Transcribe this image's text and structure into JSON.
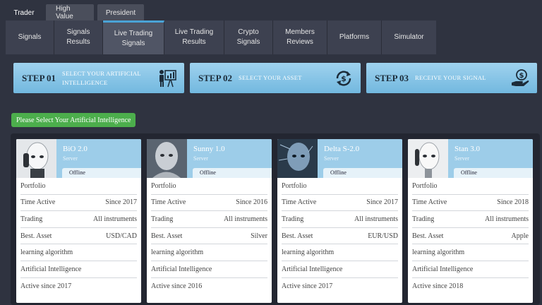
{
  "top_tabs": [
    {
      "label": "Trader",
      "active": true
    },
    {
      "label": "High Value",
      "active": false
    },
    {
      "label": "President",
      "active": false
    }
  ],
  "nav": [
    {
      "label": "Signals",
      "active": false
    },
    {
      "label": "Signals\nResults",
      "active": false
    },
    {
      "label": "Live Trading\nSignals",
      "active": true
    },
    {
      "label": "Live Trading\nResults",
      "active": false
    },
    {
      "label": "Crypto\nSignals",
      "active": false
    },
    {
      "label": "Members\nReviews",
      "active": false
    },
    {
      "label": "Platforms",
      "active": false
    },
    {
      "label": "Simulator",
      "active": false
    }
  ],
  "steps": [
    {
      "num": "STEP 01",
      "text": "SELECT YOUR ARTIFICIAL\nINTELLIGENCE",
      "icon": "presentation-chart-icon"
    },
    {
      "num": "STEP 02",
      "text": "SELECT YOUR ASSET",
      "icon": "dollar-exchange-icon"
    },
    {
      "num": "STEP 03",
      "text": "RECEIVE YOUR SIGNAL",
      "icon": "hand-coin-icon"
    }
  ],
  "select_button": "Please Select Your Artificial Intelligence",
  "cards": [
    {
      "name": "BiO 2.0",
      "subtitle": "Server",
      "status": "Offline",
      "rows": [
        {
          "label": "Portfolio",
          "value": ""
        },
        {
          "label": "Time Active",
          "value": "Since 2017"
        },
        {
          "label": "Trading",
          "value": "All instruments"
        },
        {
          "label": "Best. Asset",
          "value": "USD/CAD"
        },
        {
          "label": "learning algorithm",
          "value": ""
        },
        {
          "label": "Artificial Intelligence",
          "value": ""
        },
        {
          "label": "Active since 2017",
          "value": ""
        }
      ]
    },
    {
      "name": "Sunny 1.0",
      "subtitle": "Server",
      "status": "Offline",
      "rows": [
        {
          "label": "Portfolio",
          "value": ""
        },
        {
          "label": "Time Active",
          "value": "Since 2016"
        },
        {
          "label": "Trading",
          "value": "All instruments"
        },
        {
          "label": "Best. Asset",
          "value": "Silver"
        },
        {
          "label": "learning algorithm",
          "value": ""
        },
        {
          "label": "Artificial Intelligence",
          "value": ""
        },
        {
          "label": "Active since 2016",
          "value": ""
        }
      ]
    },
    {
      "name": "Delta S-2.0",
      "subtitle": "Server",
      "status": "Offline",
      "rows": [
        {
          "label": "Portfolio",
          "value": ""
        },
        {
          "label": "Time Active",
          "value": "Since 2017"
        },
        {
          "label": "Trading",
          "value": "All instruments"
        },
        {
          "label": "Best. Asset",
          "value": "EUR/USD"
        },
        {
          "label": "learning algorithm",
          "value": ""
        },
        {
          "label": "Artificial Intelligence",
          "value": ""
        },
        {
          "label": "Active since 2017",
          "value": ""
        }
      ]
    },
    {
      "name": "Stan 3.0",
      "subtitle": "Server",
      "status": "Offline",
      "rows": [
        {
          "label": "Portfolio",
          "value": ""
        },
        {
          "label": "Time Active",
          "value": "Since 2018"
        },
        {
          "label": "Trading",
          "value": "All instruments"
        },
        {
          "label": "Best. Asset",
          "value": "Apple"
        },
        {
          "label": "learning algorithm",
          "value": ""
        },
        {
          "label": "Artificial Intelligence",
          "value": ""
        },
        {
          "label": "Active since 2018",
          "value": ""
        }
      ]
    }
  ],
  "colors": {
    "background": "#2f3340",
    "accent": "#4aa3d6",
    "step_bg": "#9fd2ee",
    "select_green": "#4cae4c"
  }
}
